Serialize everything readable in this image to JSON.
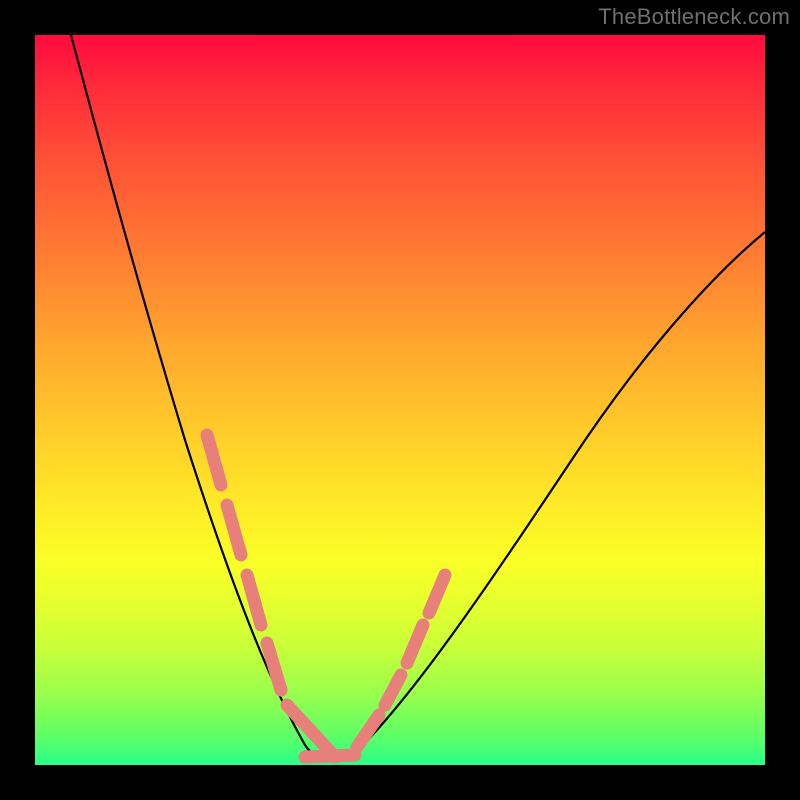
{
  "watermark": "TheBottleneck.com",
  "chart_data": {
    "type": "line",
    "title": "",
    "xlabel": "",
    "ylabel": "",
    "xlim": [
      0,
      100
    ],
    "ylim": [
      0,
      100
    ],
    "gradient_stops": [
      {
        "pos": 0,
        "color": "#ff0b3d"
      },
      {
        "pos": 8,
        "color": "#ff2e3a"
      },
      {
        "pos": 18,
        "color": "#ff5436"
      },
      {
        "pos": 30,
        "color": "#ff7c33"
      },
      {
        "pos": 42,
        "color": "#ffa52e"
      },
      {
        "pos": 54,
        "color": "#ffcb2a"
      },
      {
        "pos": 64,
        "color": "#ffe927"
      },
      {
        "pos": 72,
        "color": "#faff27"
      },
      {
        "pos": 78,
        "color": "#e5ff2e"
      },
      {
        "pos": 84,
        "color": "#c7ff3a"
      },
      {
        "pos": 90,
        "color": "#9bff4b"
      },
      {
        "pos": 96,
        "color": "#5eff66"
      },
      {
        "pos": 100,
        "color": "#29ff8a"
      }
    ],
    "series": [
      {
        "name": "bottleneck-curve",
        "color": "#000000",
        "x": [
          5,
          8,
          12,
          16,
          20,
          24,
          28,
          30,
          32,
          34,
          36,
          38,
          40,
          45,
          50,
          55,
          60,
          65,
          70,
          75,
          80,
          85,
          90,
          95,
          100
        ],
        "y": [
          100,
          90,
          79,
          68,
          57,
          46,
          35,
          28,
          21,
          14,
          8,
          3,
          0,
          4,
          10,
          17,
          25,
          33,
          41,
          48,
          55,
          61,
          66,
          70,
          73
        ]
      }
    ],
    "overlay_segments": {
      "name": "pink-highlight",
      "color": "#e77f7b",
      "thickness_px": 13,
      "segments": [
        {
          "x0": 24,
          "y0": 45,
          "x1": 26,
          "y1": 38
        },
        {
          "x0": 27,
          "y0": 35,
          "x1": 29,
          "y1": 28
        },
        {
          "x0": 30,
          "y0": 25,
          "x1": 32,
          "y1": 18
        },
        {
          "x0": 33,
          "y0": 15,
          "x1": 35,
          "y1": 8
        },
        {
          "x0": 36,
          "y0": 5,
          "x1": 42,
          "y1": 1
        },
        {
          "x0": 44,
          "y0": 3,
          "x1": 47,
          "y1": 8
        },
        {
          "x0": 48,
          "y0": 10,
          "x1": 50,
          "y1": 15
        },
        {
          "x0": 51,
          "y0": 18,
          "x1": 53,
          "y1": 25
        },
        {
          "x0": 54,
          "y0": 28,
          "x1": 56,
          "y1": 35
        }
      ]
    }
  }
}
